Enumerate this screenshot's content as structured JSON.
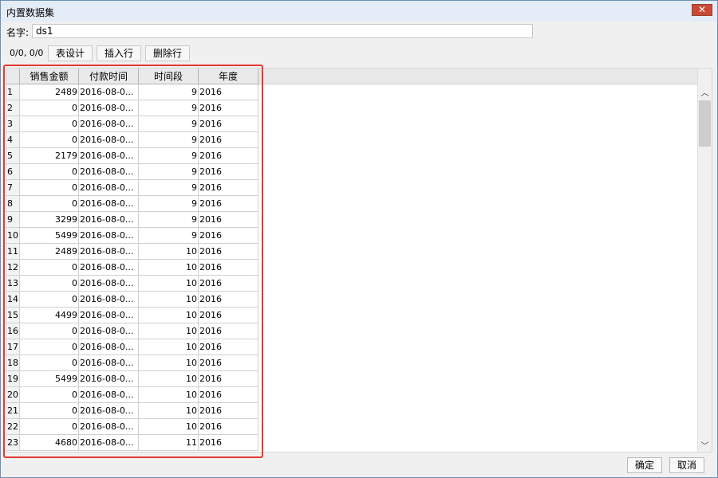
{
  "window": {
    "title": "内置数据集",
    "close_glyph": "✕"
  },
  "name": {
    "label": "名字:",
    "value": "ds1"
  },
  "toolbar": {
    "coords": "0/0, 0/0",
    "table_design": "表设计",
    "insert_row": "插入行",
    "delete_row": "删除行"
  },
  "table": {
    "columns": [
      "销售金额",
      "付款时间",
      "时间段",
      "年度"
    ],
    "rows": [
      {
        "n": "1",
        "amount": "2489",
        "time": "2016-08-0...",
        "period": "9",
        "year": "2016"
      },
      {
        "n": "2",
        "amount": "0",
        "time": "2016-08-0...",
        "period": "9",
        "year": "2016"
      },
      {
        "n": "3",
        "amount": "0",
        "time": "2016-08-0...",
        "period": "9",
        "year": "2016"
      },
      {
        "n": "4",
        "amount": "0",
        "time": "2016-08-0...",
        "period": "9",
        "year": "2016"
      },
      {
        "n": "5",
        "amount": "2179",
        "time": "2016-08-0...",
        "period": "9",
        "year": "2016"
      },
      {
        "n": "6",
        "amount": "0",
        "time": "2016-08-0...",
        "period": "9",
        "year": "2016"
      },
      {
        "n": "7",
        "amount": "0",
        "time": "2016-08-0...",
        "period": "9",
        "year": "2016"
      },
      {
        "n": "8",
        "amount": "0",
        "time": "2016-08-0...",
        "period": "9",
        "year": "2016"
      },
      {
        "n": "9",
        "amount": "3299",
        "time": "2016-08-0...",
        "period": "9",
        "year": "2016"
      },
      {
        "n": "10",
        "amount": "5499",
        "time": "2016-08-0...",
        "period": "9",
        "year": "2016"
      },
      {
        "n": "11",
        "amount": "2489",
        "time": "2016-08-0...",
        "period": "10",
        "year": "2016"
      },
      {
        "n": "12",
        "amount": "0",
        "time": "2016-08-0...",
        "period": "10",
        "year": "2016"
      },
      {
        "n": "13",
        "amount": "0",
        "time": "2016-08-0...",
        "period": "10",
        "year": "2016"
      },
      {
        "n": "14",
        "amount": "0",
        "time": "2016-08-0...",
        "period": "10",
        "year": "2016"
      },
      {
        "n": "15",
        "amount": "4499",
        "time": "2016-08-0...",
        "period": "10",
        "year": "2016"
      },
      {
        "n": "16",
        "amount": "0",
        "time": "2016-08-0...",
        "period": "10",
        "year": "2016"
      },
      {
        "n": "17",
        "amount": "0",
        "time": "2016-08-0...",
        "period": "10",
        "year": "2016"
      },
      {
        "n": "18",
        "amount": "0",
        "time": "2016-08-0...",
        "period": "10",
        "year": "2016"
      },
      {
        "n": "19",
        "amount": "5499",
        "time": "2016-08-0...",
        "period": "10",
        "year": "2016"
      },
      {
        "n": "20",
        "amount": "0",
        "time": "2016-08-0...",
        "period": "10",
        "year": "2016"
      },
      {
        "n": "21",
        "amount": "0",
        "time": "2016-08-0...",
        "period": "10",
        "year": "2016"
      },
      {
        "n": "22",
        "amount": "0",
        "time": "2016-08-0...",
        "period": "10",
        "year": "2016"
      },
      {
        "n": "23",
        "amount": "4680",
        "time": "2016-08-0...",
        "period": "11",
        "year": "2016"
      }
    ]
  },
  "scrollbar": {
    "up_glyph": "︿",
    "down_glyph": "﹀"
  },
  "footer": {
    "confirm": "确定",
    "cancel": "取消"
  },
  "colors": {
    "highlight_border": "#e53935",
    "title_bar": "#e3ecf7",
    "close_button": "#c94b35"
  }
}
